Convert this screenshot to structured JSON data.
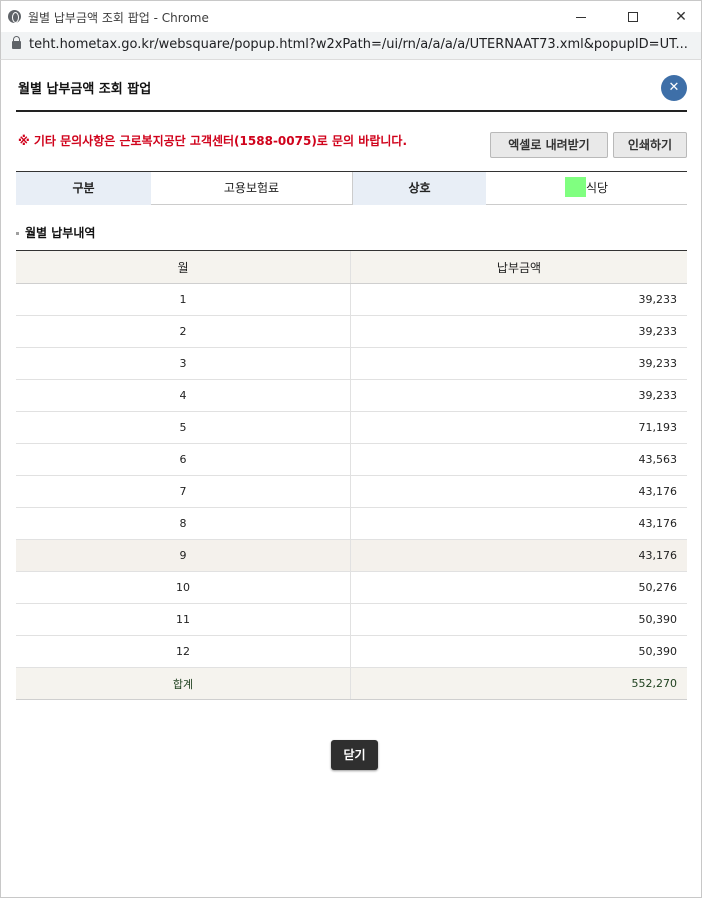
{
  "window": {
    "title": "월별 납부금액 조회 팝업 - Chrome",
    "url": "teht.hometax.go.kr/websquare/popup.html?w2xPath=/ui/rn/a/a/a/a/UTERNAAT73.xml&popupID=UT..."
  },
  "popup": {
    "title": "월별 납부금액 조회 팝업",
    "close_glyph": "✕",
    "notice": "※ 기타 문의사항은 근로복지공단 고객센터(1588-0075)로 문의 바랍니다.",
    "excel_button": "엑셀로 내려받기",
    "print_button": "인쇄하기"
  },
  "info": {
    "category_label": "구분",
    "category_value": "고용보험료",
    "company_label": "상호",
    "company_suffix": "식당"
  },
  "section": {
    "title": "월별 납부내역"
  },
  "grid": {
    "columns": [
      "월",
      "납부금액"
    ],
    "rows": [
      {
        "month": "1",
        "amount": "39,233"
      },
      {
        "month": "2",
        "amount": "39,233"
      },
      {
        "month": "3",
        "amount": "39,233"
      },
      {
        "month": "4",
        "amount": "39,233"
      },
      {
        "month": "5",
        "amount": "71,193"
      },
      {
        "month": "6",
        "amount": "43,563"
      },
      {
        "month": "7",
        "amount": "43,176"
      },
      {
        "month": "8",
        "amount": "43,176"
      },
      {
        "month": "9",
        "amount": "43,176"
      },
      {
        "month": "10",
        "amount": "50,276"
      },
      {
        "month": "11",
        "amount": "50,390"
      },
      {
        "month": "12",
        "amount": "50,390"
      }
    ],
    "highlighted_row_index": 8,
    "total_label": "합계",
    "total_amount": "552,270"
  },
  "footer": {
    "close_button": "닫기"
  },
  "colors": {
    "notice_red": "#d0021b",
    "close_blue": "#3e6fa8",
    "redaction_green": "#80ff80"
  }
}
